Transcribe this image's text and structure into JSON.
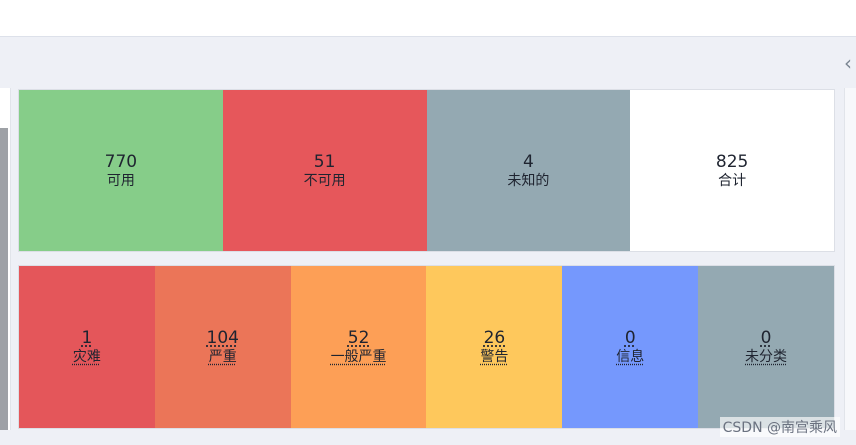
{
  "status_counts": [
    {
      "value": "770",
      "label": "可用",
      "color": "#86cd89"
    },
    {
      "value": "51",
      "label": "不可用",
      "color": "#e6575b"
    },
    {
      "value": "4",
      "label": "未知的",
      "color": "#94a9b2"
    },
    {
      "value": "825",
      "label": "合计",
      "color": "#ffffff"
    }
  ],
  "severity_counts": [
    {
      "value": "1",
      "label": "灾难",
      "color": "#e4565a"
    },
    {
      "value": "104",
      "label": "严重",
      "color": "#eb7558"
    },
    {
      "value": "52",
      "label": "一般严重",
      "color": "#fd9f56"
    },
    {
      "value": "26",
      "label": "警告",
      "color": "#fec85c"
    },
    {
      "value": "0",
      "label": "信息",
      "color": "#7598fd"
    },
    {
      "value": "0",
      "label": "未分类",
      "color": "#94a9b2"
    }
  ],
  "collapse_icon": "chevron-left-icon",
  "watermark": "CSDN @南宫乘风"
}
